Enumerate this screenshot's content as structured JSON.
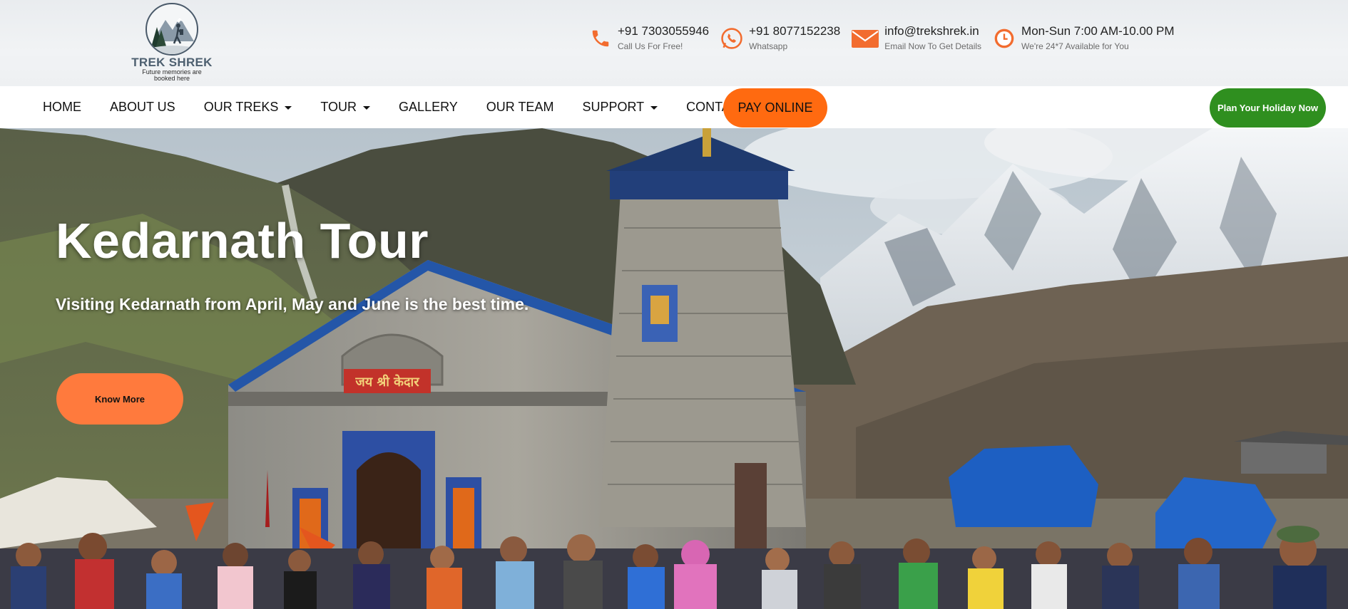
{
  "brand": {
    "name": "TREK SHREK",
    "tagline": "Future memories are booked here"
  },
  "contacts": [
    {
      "icon": "phone-icon",
      "main": "+91 7303055946",
      "sub": "Call Us For Free!"
    },
    {
      "icon": "whatsapp-icon",
      "main": "+91 8077152238",
      "sub": "Whatsapp"
    },
    {
      "icon": "email-icon",
      "main": "info@trekshrek.in",
      "sub": "Email Now To Get Details"
    },
    {
      "icon": "clock-icon",
      "main": "Mon-Sun 7:00 AM-10.00 PM",
      "sub": "We're 24*7 Available for You"
    }
  ],
  "nav": {
    "items": [
      {
        "label": "HOME"
      },
      {
        "label": "ABOUT US"
      },
      {
        "label": "OUR TREKS",
        "dropdown": true
      },
      {
        "label": "TOUR",
        "dropdown": true
      },
      {
        "label": "GALLERY"
      },
      {
        "label": "OUR TEAM"
      },
      {
        "label": "SUPPORT",
        "dropdown": true
      },
      {
        "label": "CONTACT US"
      }
    ],
    "pay_label": "PAY ONLINE",
    "plan_label": "Plan Your Holiday Now"
  },
  "hero": {
    "title": "Kedarnath Tour",
    "subtitle": "Visiting Kedarnath from April, May and June is the best time.",
    "button_label": "Know More",
    "temple_sign": "जय श्री केदार"
  },
  "colors": {
    "accent_orange": "#ff6a10",
    "button_orange": "#ff7a3d",
    "plan_green": "#2f8f1f",
    "icon_orange": "#f26c2f"
  }
}
